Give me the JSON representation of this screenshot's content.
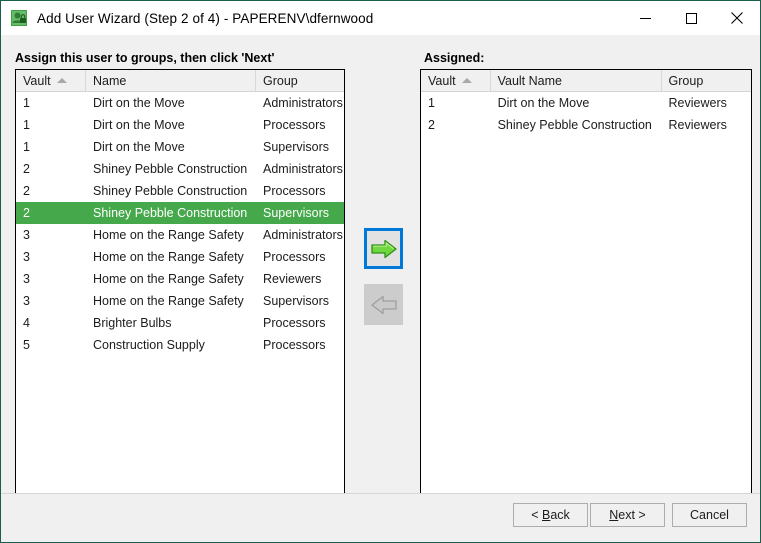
{
  "window": {
    "title": "Add User Wizard (Step 2 of 4) - PAPERENV\\dfernwood",
    "icon": "user-vault-icon",
    "controls": {
      "minimize": "minimize-icon",
      "maximize": "maximize-icon",
      "close": "close-icon"
    },
    "border_color": "#1b5e4b"
  },
  "instruction": "Assign this user to groups, then click 'Next'",
  "assigned_label": "Assigned:",
  "available_list": {
    "columns": [
      "Vault",
      "Name",
      "Group"
    ],
    "sort_column": "Vault",
    "sort_direction": "ascending",
    "selected_index": 5,
    "rows": [
      {
        "vault": "1",
        "name": "Dirt on the Move",
        "group": "Administrators"
      },
      {
        "vault": "1",
        "name": "Dirt on the Move",
        "group": "Processors"
      },
      {
        "vault": "1",
        "name": "Dirt on the Move",
        "group": "Supervisors"
      },
      {
        "vault": "2",
        "name": "Shiney Pebble Construction",
        "group": "Administrators"
      },
      {
        "vault": "2",
        "name": "Shiney Pebble Construction",
        "group": "Processors"
      },
      {
        "vault": "2",
        "name": "Shiney Pebble Construction",
        "group": "Supervisors"
      },
      {
        "vault": "3",
        "name": "Home on the Range Safety",
        "group": "Administrators"
      },
      {
        "vault": "3",
        "name": "Home on the Range Safety",
        "group": "Processors"
      },
      {
        "vault": "3",
        "name": "Home on the Range Safety",
        "group": "Reviewers"
      },
      {
        "vault": "3",
        "name": "Home on the Range Safety",
        "group": "Supervisors"
      },
      {
        "vault": "4",
        "name": "Brighter Bulbs",
        "group": "Processors"
      },
      {
        "vault": "5",
        "name": "Construction Supply",
        "group": "Processors"
      }
    ]
  },
  "assigned_list": {
    "columns": [
      "Vault",
      "Vault Name",
      "Group"
    ],
    "sort_column": "Vault",
    "sort_direction": "ascending",
    "rows": [
      {
        "vault": "1",
        "name": "Dirt on the Move",
        "group": "Reviewers"
      },
      {
        "vault": "2",
        "name": "Shiney Pebble Construction",
        "group": "Reviewers"
      }
    ]
  },
  "transfer": {
    "add": {
      "name": "move-right-arrow-icon",
      "enabled": true,
      "focused": true,
      "color": "#5dc52f"
    },
    "remove": {
      "name": "move-left-arrow-icon",
      "enabled": false,
      "color": "#bdbdbd"
    }
  },
  "footer_buttons": [
    {
      "id": "back",
      "prefix": "< ",
      "accel": "B",
      "suffix": "ack"
    },
    {
      "id": "next",
      "prefix": "",
      "accel": "N",
      "suffix": "ext >"
    },
    {
      "id": "cancel",
      "prefix": "",
      "accel": "",
      "suffix": "Cancel"
    }
  ],
  "colors": {
    "selection_green": "#45a94b",
    "focus_blue": "#0078d7",
    "dialog_face": "#f0f0f0"
  }
}
